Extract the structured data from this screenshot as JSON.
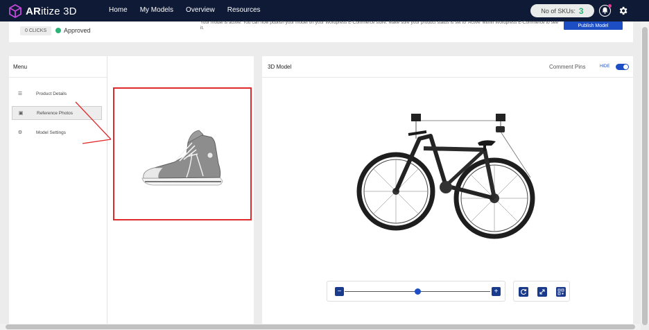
{
  "app": {
    "brand_strong": "AR",
    "brand_rest": "itize 3D"
  },
  "nav": [
    "Home",
    "My Models",
    "Overview",
    "Resources"
  ],
  "sku": {
    "label": "No of SKUs:",
    "count": "3"
  },
  "icons": {
    "logo": "cube-logo-icon",
    "bell": "bell-icon",
    "settings": "gear-icon"
  },
  "status": {
    "clicks": "0 CLICKS",
    "approved": "Approved",
    "notice": "Your model is active. You can now publish your model on your Wordpress E-Commerce store. Make sure your product status is set to 'Active' within Wordpress E-Commerce to see it.",
    "publish_button": "Publish Model"
  },
  "menu": {
    "title": "Menu",
    "items": [
      {
        "label": "Product Details",
        "icon": "list-icon",
        "active": false
      },
      {
        "label": "Reference Photos",
        "icon": "image-icon",
        "active": true
      },
      {
        "label": "Model Settings",
        "icon": "settings-icon",
        "active": false
      }
    ]
  },
  "reference_photo": {
    "subject": "grey high-top sneaker"
  },
  "viewer": {
    "title": "3D Model",
    "comment_pins": "Comment Pins",
    "hide": "HIDE",
    "toggle_on": true,
    "model_subject": "bicycle on ceiling hoist",
    "zoom_level": 0.5
  },
  "colors": {
    "topbar": "#0f1a36",
    "accent": "#1d4ec4",
    "approved": "#2bb37a",
    "annotation": "#e02a2a"
  }
}
